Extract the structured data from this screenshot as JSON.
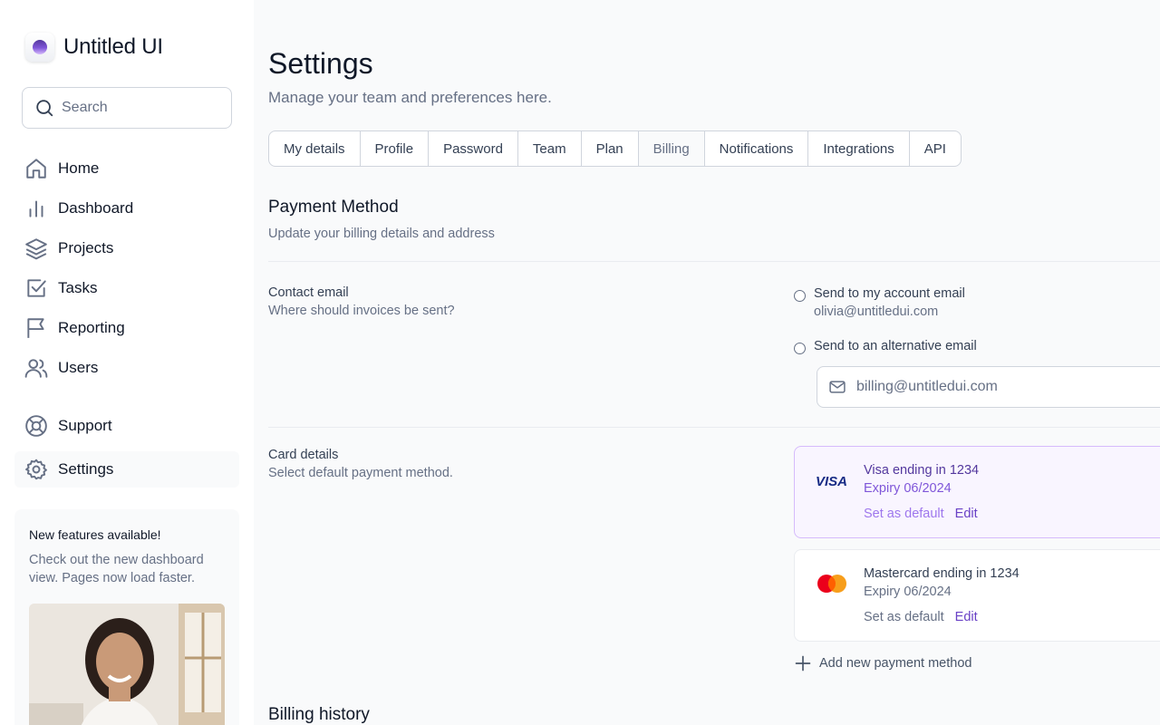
{
  "app": {
    "name": "Untitled UI"
  },
  "sidebar": {
    "search_placeholder": "Search",
    "nav": [
      {
        "label": "Home",
        "icon": "home-icon"
      },
      {
        "label": "Dashboard",
        "icon": "bar-chart-icon"
      },
      {
        "label": "Projects",
        "icon": "layers-icon"
      },
      {
        "label": "Tasks",
        "icon": "check-square-icon"
      },
      {
        "label": "Reporting",
        "icon": "flag-icon"
      },
      {
        "label": "Users",
        "icon": "users-icon"
      }
    ],
    "footer_nav": [
      {
        "label": "Support",
        "icon": "life-buoy-icon"
      },
      {
        "label": "Settings",
        "icon": "gear-icon",
        "active": true
      }
    ],
    "promo": {
      "title": "New features available!",
      "text": "Check out the new dashboard view. Pages now load faster."
    }
  },
  "page": {
    "title": "Settings",
    "subtitle": "Manage your team and preferences here.",
    "tabs": [
      "My details",
      "Profile",
      "Password",
      "Team",
      "Plan",
      "Billing",
      "Notifications",
      "Integrations",
      "API"
    ],
    "active_tab": "Billing"
  },
  "payment": {
    "title": "Payment Method",
    "subtitle": "Update your billing details and address",
    "contact": {
      "label": "Contact email",
      "sub": "Where should invoices be sent?",
      "option_account_label": "Send to my account email",
      "option_account_email": "olivia@untitledui.com",
      "option_alt_label": "Send to an alternative email",
      "alt_email_placeholder": "billing@untitledui.com"
    },
    "cards_section": {
      "label": "Card details",
      "sub": "Select default payment method.",
      "cards": [
        {
          "name": "Visa ending in 1234",
          "expiry": "Expiry 06/2024",
          "default_label": "Set as default",
          "edit_label": "Edit",
          "brand": "VISA",
          "selected": true
        },
        {
          "name": "Mastercard ending in 1234",
          "expiry": "Expiry 06/2024",
          "default_label": "Set as default",
          "edit_label": "Edit",
          "brand": "mastercard",
          "selected": false
        }
      ],
      "add_label": "Add new payment method"
    }
  },
  "billing_history": {
    "title": "Billing history"
  },
  "colors": {
    "accent": "#7f56d9",
    "accent_dark": "#53389e",
    "border": "#d0d5dd",
    "text_muted": "#667085"
  }
}
